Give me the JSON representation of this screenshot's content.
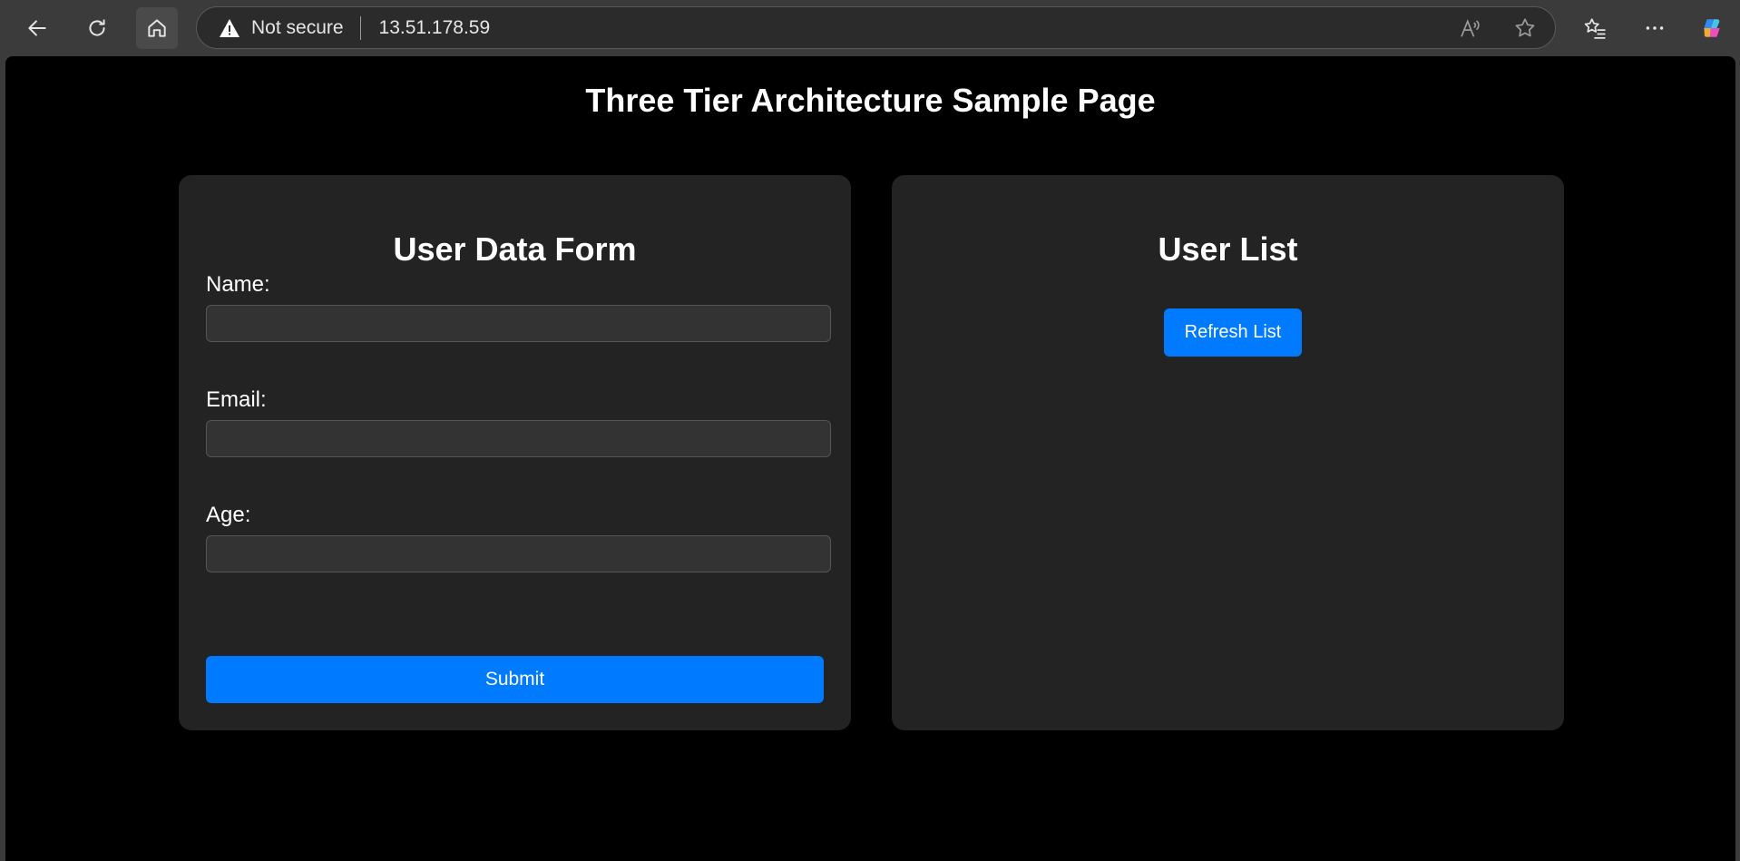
{
  "browser": {
    "security_label": "Not secure",
    "url": "13.51.178.59",
    "icons": [
      "back-icon",
      "refresh-icon",
      "home-icon",
      "warning-icon",
      "read-aloud-icon",
      "favorite-star-icon",
      "favorites-icon",
      "more-icon",
      "copilot-icon"
    ]
  },
  "page": {
    "title": "Three Tier Architecture Sample Page"
  },
  "form": {
    "heading": "User Data Form",
    "name_label": "Name:",
    "name_value": "",
    "email_label": "Email:",
    "email_value": "",
    "age_label": "Age:",
    "age_value": "",
    "submit_label": "Submit"
  },
  "user_list": {
    "heading": "User List",
    "refresh_label": "Refresh List"
  },
  "colors": {
    "accent": "#007bff",
    "background": "#000000",
    "card": "#232323"
  }
}
